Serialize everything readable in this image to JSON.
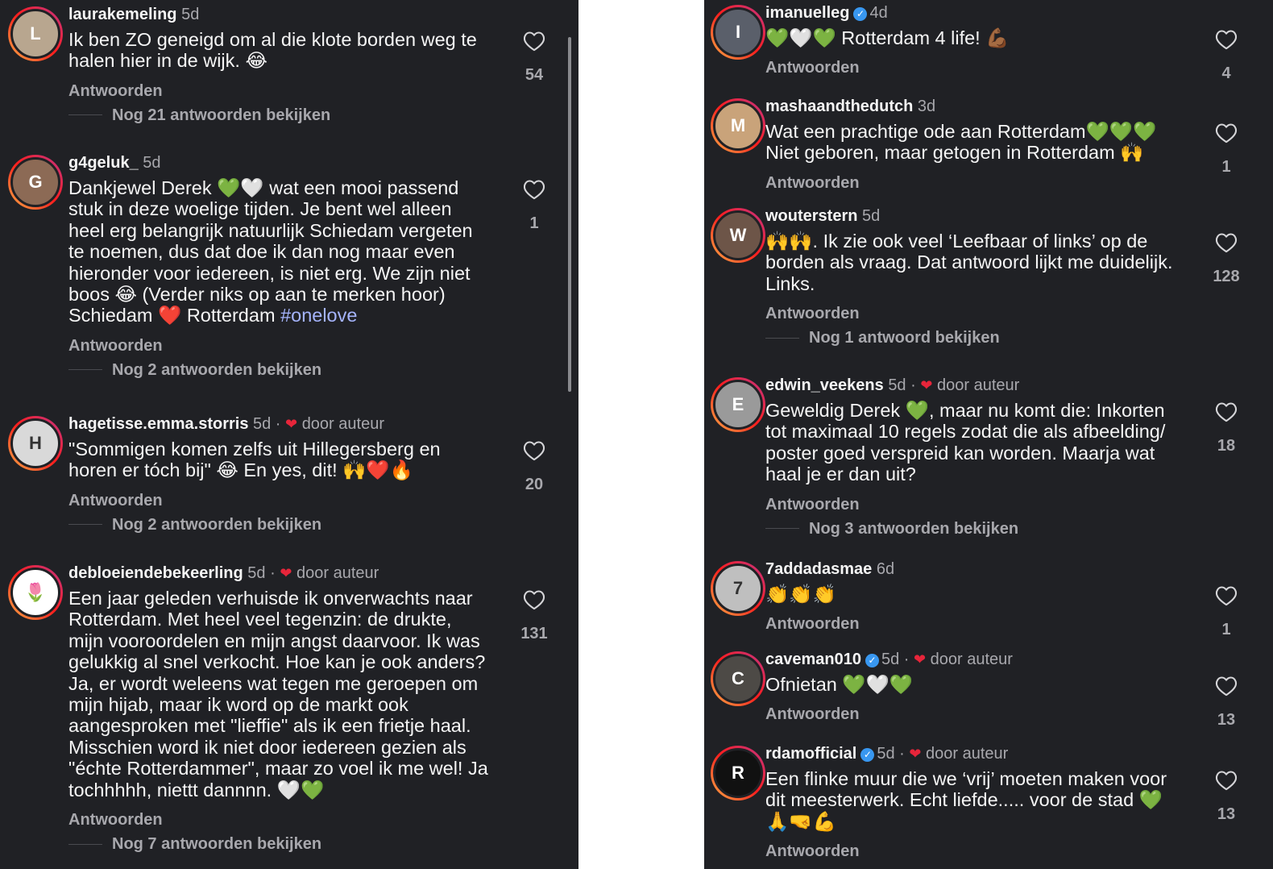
{
  "left_comments": [
    {
      "username": "laurakemeling",
      "verified": false,
      "time": "5d",
      "by_author": false,
      "by_author_label": "",
      "text": "Ik ben ZO geneigd om al die klote borden weg te\nhalen hier in de wijk. 😂",
      "reply_label": "Antwoorden",
      "view_replies": "Nog 21 antwoorden bekijken",
      "likes": "54",
      "avatar_initial": "L",
      "avatar_color": "#b8a68f"
    },
    {
      "username": "g4geluk_",
      "verified": false,
      "time": "5d",
      "by_author": false,
      "by_author_label": "",
      "text": "Dankjewel Derek 💚🤍 wat een mooi passend\nstuk in deze woelige tijden. Je bent wel alleen\nheel erg belangrijk natuurlijk Schiedam vergeten\nte noemen, dus dat doe ik dan nog maar even\nhieronder voor iedereen, is niet erg. We zijn niet\nboos 😂 (Verder niks op aan te merken hoor)\nSchiedam ❤️ Rotterdam",
      "hashtag": "#onelove",
      "reply_label": "Antwoorden",
      "view_replies": "Nog 2 antwoorden bekijken",
      "likes": "1",
      "avatar_initial": "G",
      "avatar_color": "#8c6a55"
    },
    {
      "username": "hagetisse.emma.storris",
      "verified": false,
      "time": "5d",
      "by_author": true,
      "by_author_label": "door auteur",
      "text": "\"Sommigen komen zelfs uit Hillegersberg en\nhoren er tóch bij\" 😂 En yes, dit! 🙌❤️🔥",
      "reply_label": "Antwoorden",
      "view_replies": "Nog 2 antwoorden bekijken",
      "likes": "20",
      "avatar_initial": "H",
      "avatar_color": "#d9d9d9"
    },
    {
      "username": "debloeiendebekeerling",
      "verified": false,
      "time": "5d",
      "by_author": true,
      "by_author_label": "door auteur",
      "text": "Een jaar geleden verhuisde ik onverwachts naar\nRotterdam. Met heel veel tegenzin: de drukte,\nmijn vooroordelen en mijn angst daarvoor. Ik was\ngelukkig al snel verkocht. Hoe kan je ook anders?\nJa, er wordt weleens wat tegen me geroepen om\nmijn hijab, maar ik word op de markt ook\naangesproken met \"lieffie\" als ik een frietje haal.\nMisschien word ik niet door iedereen gezien als\n\"échte Rotterdammer\", maar zo voel ik me wel! Ja\ntochhhhh, niettt dannnn. 🤍💚",
      "reply_label": "Antwoorden",
      "view_replies": "Nog 7 antwoorden bekijken",
      "likes": "131",
      "avatar_initial": "🌷",
      "avatar_color": "#ffffff"
    }
  ],
  "right_comments": [
    {
      "username": "imanuelleg",
      "verified": true,
      "time": "4d",
      "by_author": false,
      "by_author_label": "",
      "text": "💚🤍💚 Rotterdam 4 life! 💪🏾",
      "reply_label": "Antwoorden",
      "view_replies": "",
      "likes": "4",
      "avatar_initial": "I",
      "avatar_color": "#5a5f6a"
    },
    {
      "username": "mashaandthedutch",
      "verified": false,
      "time": "3d",
      "by_author": false,
      "by_author_label": "",
      "text": "Wat een prachtige ode aan Rotterdam💚💚💚\nNiet geboren, maar getogen in Rotterdam 🙌",
      "reply_label": "Antwoorden",
      "view_replies": "",
      "likes": "1",
      "avatar_initial": "M",
      "avatar_color": "#c9a37a"
    },
    {
      "username": "wouterstern",
      "verified": false,
      "time": "5d",
      "by_author": false,
      "by_author_label": "",
      "text": "🙌🙌. Ik zie ook veel ‘Leefbaar of links’ op de\nborden als vraag. Dat antwoord lijkt me duidelijk.\nLinks.",
      "reply_label": "Antwoorden",
      "view_replies": "Nog 1 antwoord bekijken",
      "likes": "128",
      "avatar_initial": "W",
      "avatar_color": "#6d5548"
    },
    {
      "username": "edwin_veekens",
      "verified": false,
      "time": "5d",
      "by_author": true,
      "by_author_label": "door auteur",
      "text": "Geweldig Derek 💚, maar nu komt die: Inkorten\ntot maximaal 10 regels zodat die als afbeelding/\nposter goed verspreid kan worden. Maarja wat\nhaal je er dan uit?",
      "reply_label": "Antwoorden",
      "view_replies": "Nog 3 antwoorden bekijken",
      "likes": "18",
      "avatar_initial": "E",
      "avatar_color": "#9a9a9a"
    },
    {
      "username": "7addadasmae",
      "verified": false,
      "time": "6d",
      "by_author": false,
      "by_author_label": "",
      "text": "👏👏👏",
      "reply_label": "Antwoorden",
      "view_replies": "",
      "likes": "1",
      "avatar_initial": "7",
      "avatar_color": "#bfbfbf"
    },
    {
      "username": "caveman010",
      "verified": true,
      "time": "5d",
      "by_author": true,
      "by_author_label": "door auteur",
      "text": "Ofnietan 💚🤍💚",
      "reply_label": "Antwoorden",
      "view_replies": "",
      "likes": "13",
      "avatar_initial": "C",
      "avatar_color": "#4d4a46"
    },
    {
      "username": "rdamofficial",
      "verified": true,
      "time": "5d",
      "by_author": true,
      "by_author_label": "door auteur",
      "text": "Een flinke muur die we ‘vrij’ moeten maken voor\ndit meesterwerk. Echt liefde..... voor de stad 💚\n🙏🤜💪",
      "reply_label": "Antwoorden",
      "view_replies": "",
      "likes": "13",
      "avatar_initial": "R",
      "avatar_color": "#111111"
    }
  ],
  "colors": {
    "background": "#202125",
    "text_primary": "#f5f5f5",
    "text_secondary": "#a8a8ad",
    "hashtag": "#a5b4fc",
    "author_heart": "#e7253a",
    "verified": "#3897f0"
  },
  "icons": {
    "like": "heart-outline-icon",
    "author": "red-heart-icon",
    "verified": "verified-badge-icon"
  }
}
